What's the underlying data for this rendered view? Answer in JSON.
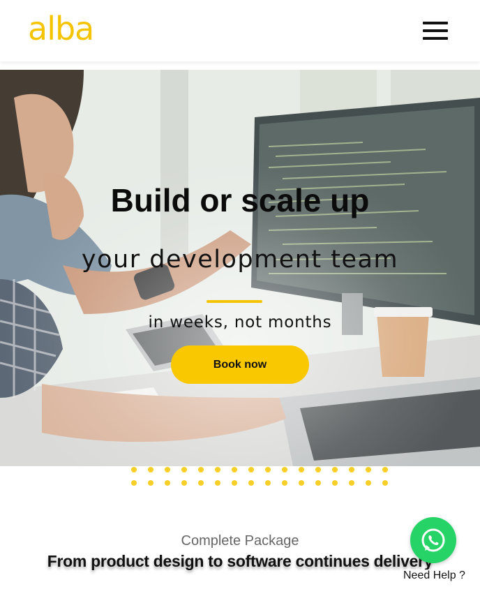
{
  "header": {
    "logo_text": "alba",
    "menu_icon": "hamburger-menu-icon"
  },
  "hero": {
    "title": "Build or scale up",
    "subtitle": "your development team",
    "tagline": "in weeks, not months",
    "cta_label": "Book now",
    "background_image": "developers-at-computer-photo"
  },
  "section": {
    "eyebrow": "Complete Package",
    "title": "From product design to software continues delivery"
  },
  "whatsapp": {
    "icon": "whatsapp-icon",
    "help_label": "Need Help ?"
  },
  "colors": {
    "accent": "#f9c800",
    "whatsapp": "#25d366",
    "text": "#111111",
    "muted": "#666666"
  }
}
